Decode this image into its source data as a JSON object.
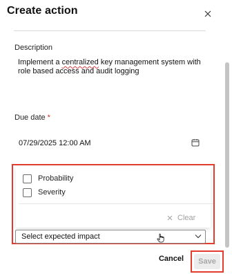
{
  "dialog": {
    "title": "Create action",
    "close_icon": "close-icon"
  },
  "form": {
    "description_label": "Description",
    "description_prefix": "Implement a ",
    "description_misspelled": "centralized",
    "description_suffix": " key management system with role based access and audit logging",
    "due_date_label": "Due date",
    "due_date_required_marker": "*",
    "due_date_value": "07/29/2025 12:00 AM",
    "calendar_icon": "calendar-icon"
  },
  "impact": {
    "options": [
      {
        "label": "Probability",
        "checked": false
      },
      {
        "label": "Severity",
        "checked": false
      }
    ],
    "clear_label": "Clear",
    "select_value": "Select expected impact",
    "chevron_icon": "chevron-down-icon"
  },
  "footer": {
    "cancel_label": "Cancel",
    "save_label": "Save",
    "save_disabled": true
  },
  "colors": {
    "highlight": "#e33c2e",
    "required": "#d0281e",
    "disabled_text": "#a8a8a8"
  }
}
